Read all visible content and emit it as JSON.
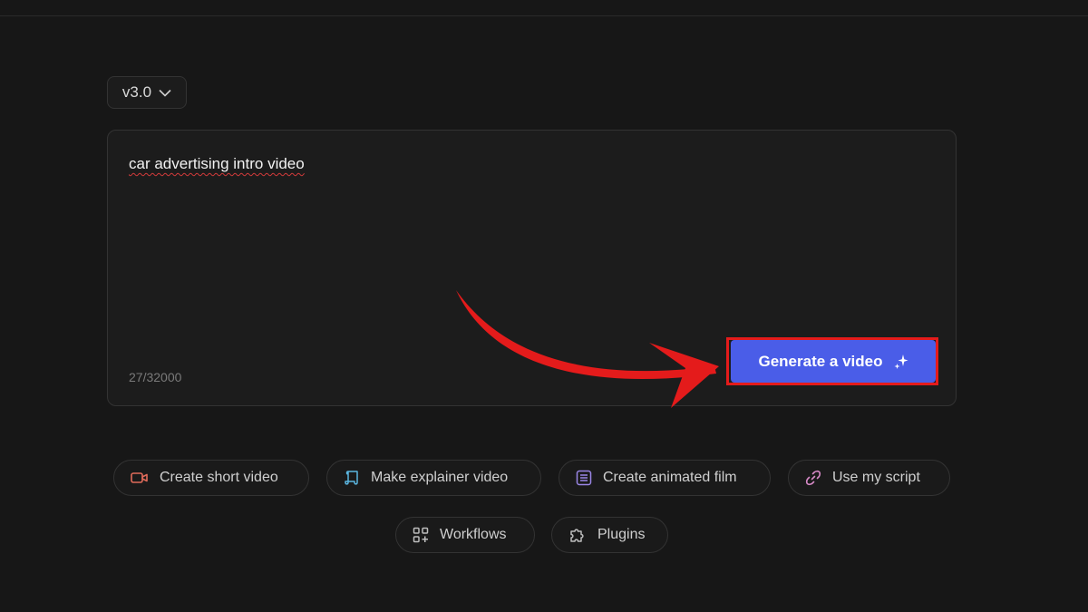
{
  "version": {
    "selected": "v3.0"
  },
  "prompt": {
    "text": "car advertising intro video",
    "char_count": "27/32000"
  },
  "generate": {
    "label": "Generate a video"
  },
  "quick_actions": [
    {
      "label": "Create short video",
      "icon": "video-camera-icon"
    },
    {
      "label": "Make explainer video",
      "icon": "scroll-icon"
    },
    {
      "label": "Create animated film",
      "icon": "document-lines-icon"
    },
    {
      "label": "Use my script",
      "icon": "link-icon"
    }
  ],
  "secondary_actions": [
    {
      "label": "Workflows",
      "icon": "grid-plus-icon"
    },
    {
      "label": "Plugins",
      "icon": "puzzle-icon"
    }
  ],
  "colors": {
    "background": "#171717",
    "card": "#1c1c1c",
    "accent": "#4a5de8",
    "annotation": "#e41b1b"
  }
}
